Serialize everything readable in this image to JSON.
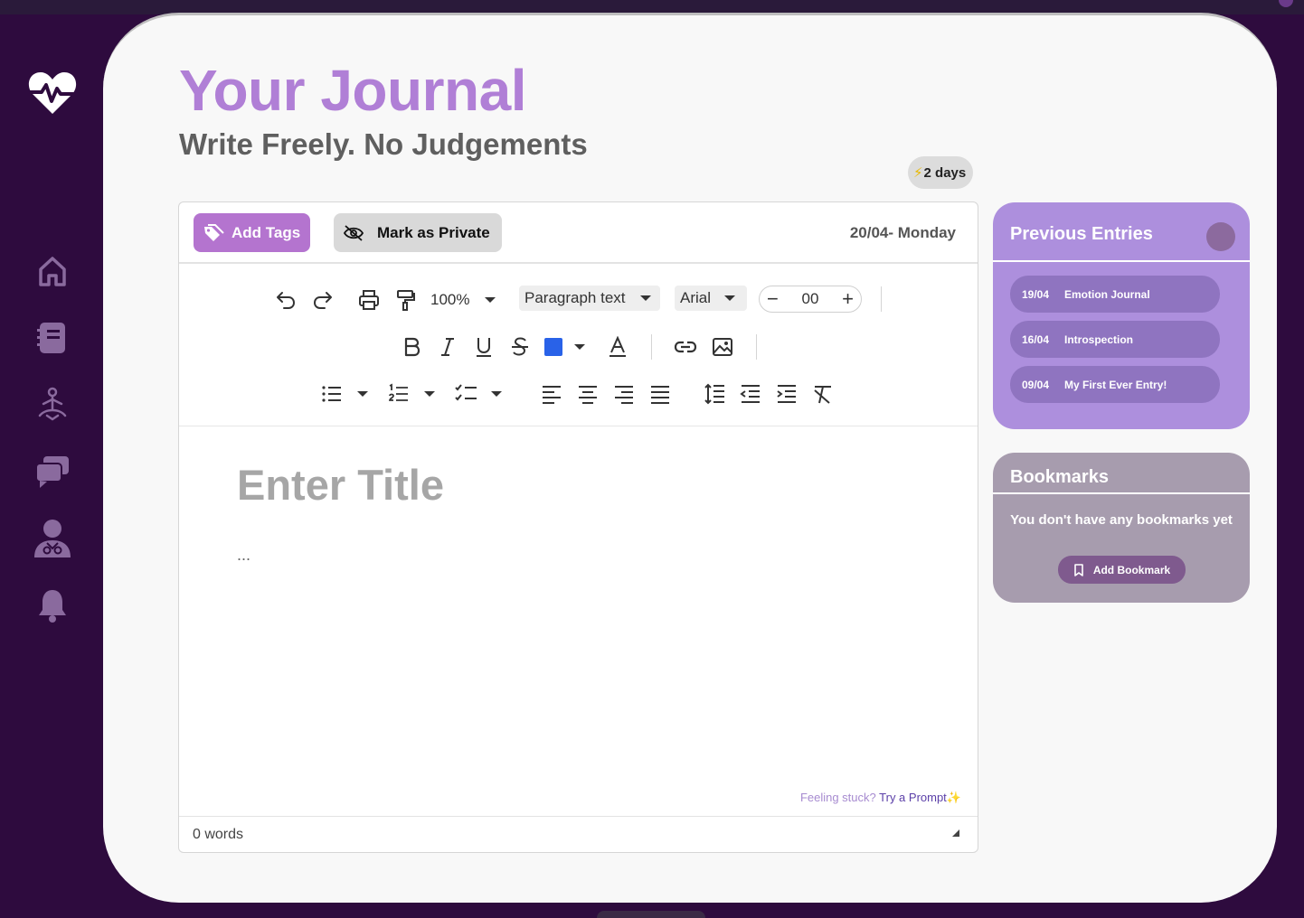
{
  "header": {
    "title": "Your Journal",
    "subtitle": "Write Freely. No Judgements",
    "streak_icon": "⚡",
    "streak_label": "2 days"
  },
  "sidebar": {
    "items": [
      {
        "name": "home-icon"
      },
      {
        "name": "journal-icon"
      },
      {
        "name": "meditation-icon"
      },
      {
        "name": "chat-icon"
      },
      {
        "name": "doctor-icon"
      },
      {
        "name": "bell-icon"
      }
    ],
    "icon_color": "#8a6a9e",
    "logo_icon": "heart-pulse-icon"
  },
  "editor": {
    "add_tags_label": "Add Tags",
    "private_label": "Mark as Private",
    "date_label": "20/04- Monday",
    "toolbar": {
      "zoom": "100%",
      "block_style": "Paragraph text",
      "font": "Arial",
      "font_size": "00",
      "text_color": "#2962e8"
    },
    "title_placeholder": "Enter Title",
    "body_placeholder": "...",
    "prompt_hint": "Feeling stuck?",
    "prompt_link": "Try a Prompt",
    "prompt_spark": "✨",
    "word_count": "0 words"
  },
  "previous_entries": {
    "title": "Previous Entries",
    "entries": [
      {
        "date": "19/04",
        "title": "Emotion Journal"
      },
      {
        "date": "16/04",
        "title": "Introspection"
      },
      {
        "date": "09/04",
        "title": "My First Ever Entry!"
      }
    ]
  },
  "bookmarks": {
    "title": "Bookmarks",
    "empty_text": "You don't have any bookmarks yet",
    "add_label": "Add Bookmark"
  },
  "colors": {
    "accent": "#b07fd6",
    "background": "#2e0b3e",
    "card": "#f8f8f8"
  }
}
